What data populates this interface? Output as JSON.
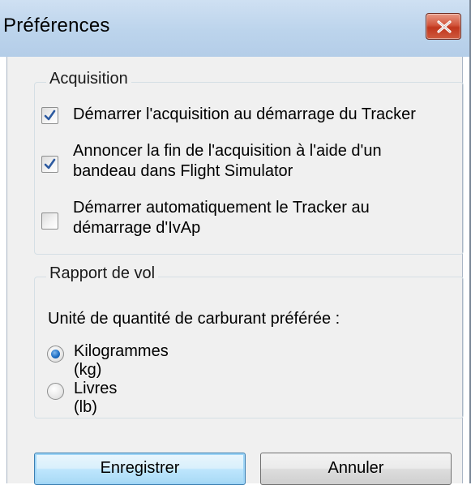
{
  "window": {
    "title": "Préférences",
    "close_icon": "close-icon"
  },
  "acquisition": {
    "legend": "Acquisition",
    "options": [
      {
        "label": "Démarrer l'acquisition au démarrage du Tracker",
        "checked": true
      },
      {
        "label": "Annoncer la fin de l'acquisition à l'aide d'un\nbandeau dans Flight Simulator",
        "checked": true
      },
      {
        "label": "Démarrer automatiquement le Tracker au\ndémarrage d'IvAp",
        "checked": false
      }
    ]
  },
  "flight_report": {
    "legend": "Rapport de vol",
    "fuel_unit_label": "Unité de quantité de carburant préférée :",
    "units": [
      {
        "label": "Kilogrammes (kg)",
        "selected": true
      },
      {
        "label": "Livres (lb)",
        "selected": false
      }
    ]
  },
  "buttons": {
    "save_label": "Enregistrer",
    "cancel_label": "Annuler"
  },
  "colors": {
    "close_button": "#c0361d",
    "accent": "#3c7fb1",
    "check_mark": "#2c5aa0"
  }
}
